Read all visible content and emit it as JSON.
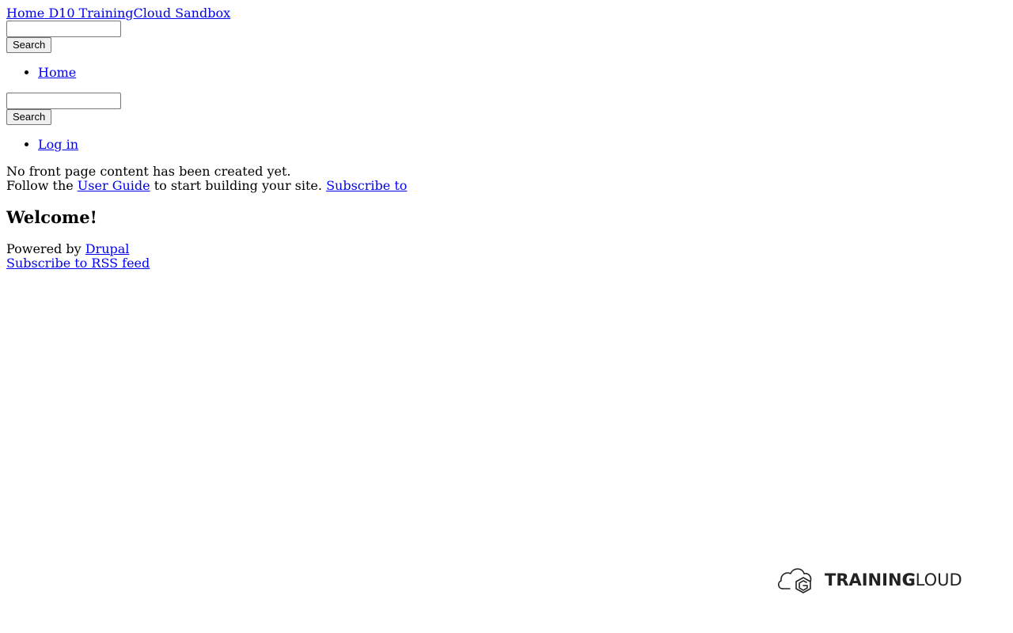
{
  "header": {
    "logo_alt": "Home",
    "site_name": " D10 Training",
    "site_name_tail": "Cloud Sandbox"
  },
  "search_top": {
    "button_label": "Search"
  },
  "main_menu": {
    "items": [
      {
        "label": "Home"
      }
    ]
  },
  "search_secondary": {
    "button_label": "Search"
  },
  "account_menu": {
    "items": [
      {
        "label": "Log in"
      }
    ]
  },
  "content": {
    "empty_message": "No front page content has been created yet.",
    "follow_prefix": "Follow the ",
    "user_guide_link": "User Guide",
    "follow_suffix": " to start building your site. ",
    "subscribe_link": "Subscribe to",
    "heading": "Welcome!"
  },
  "footer": {
    "powered_prefix": "Powered by ",
    "drupal_link": "Drupal",
    "rss_link": "Subscribe to RSS feed"
  },
  "brand_logo": {
    "text_bold": "TRAINING",
    "text_light": "CLOUD",
    "icon": "cloud-hexagon-icon",
    "color": "#222222"
  }
}
